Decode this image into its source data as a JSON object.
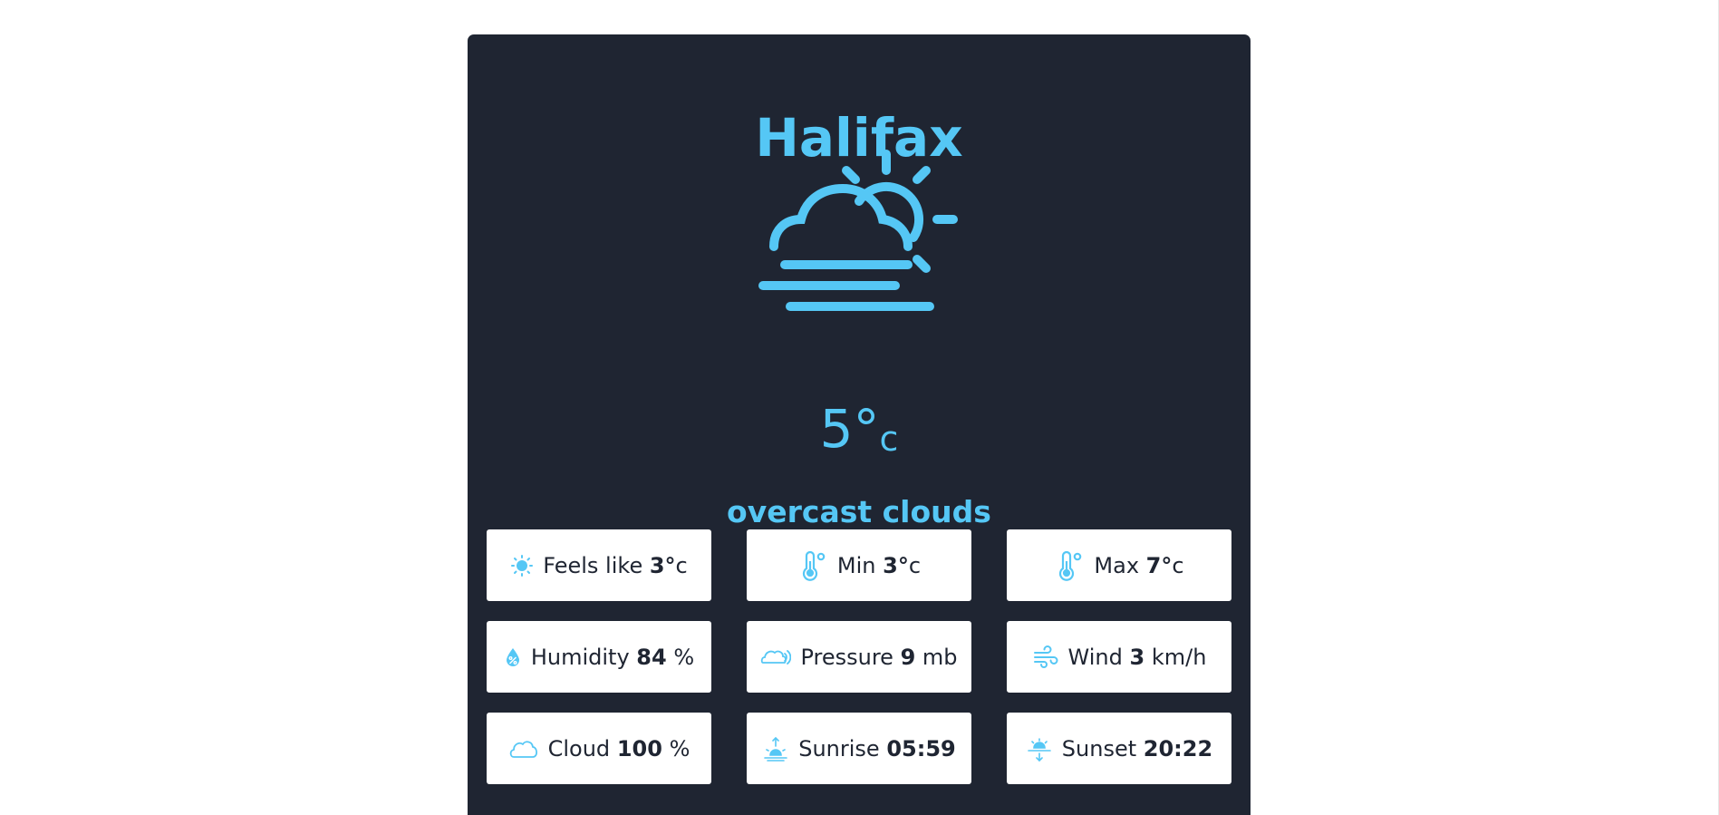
{
  "city": "Halifax",
  "temperature": {
    "value": "5°",
    "unit": "c"
  },
  "description": "overcast clouds",
  "hero_icon": "sun-behind-cloud-with-fog-icon",
  "accent_color": "#55c7f5",
  "card_color": "#1f2532",
  "tiles": [
    {
      "label": "Feels like",
      "value": "3°",
      "unit": "c",
      "icon": "feels-like-icon"
    },
    {
      "label": "Min",
      "value": "3°",
      "unit": "c",
      "icon": "thermometer-icon"
    },
    {
      "label": "Max",
      "value": "7°",
      "unit": "c",
      "icon": "thermometer-icon"
    },
    {
      "label": "Humidity",
      "value": "84",
      "unit": "%",
      "icon": "humidity-drop-icon"
    },
    {
      "label": "Pressure",
      "value": "9",
      "unit": "mb",
      "icon": "pressure-icon"
    },
    {
      "label": "Wind",
      "value": "3",
      "unit": "km/h",
      "icon": "wind-icon"
    },
    {
      "label": "Cloud",
      "value": "100",
      "unit": "%",
      "icon": "cloud-icon"
    },
    {
      "label": "Sunrise",
      "value": "05:59",
      "unit": "",
      "icon": "sunrise-icon"
    },
    {
      "label": "Sunset",
      "value": "20:22",
      "unit": "",
      "icon": "sunset-icon"
    }
  ]
}
